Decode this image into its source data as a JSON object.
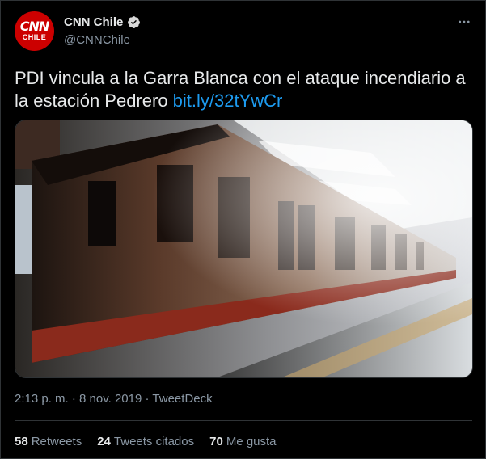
{
  "account": {
    "avatar_line1": "CNN",
    "avatar_line2": "CHILE",
    "display_name": "CNN Chile",
    "handle": "@CNNChile"
  },
  "tweet": {
    "text": "PDI vincula a la Garra Blanca con el ataque incendiario a la estación Pedrero ",
    "link": "bit.ly/32tYwCr",
    "time": "2:13 p. m.",
    "separator": "·",
    "date": "8 nov. 2019",
    "source": "TweetDeck"
  },
  "stats": [
    {
      "count": "58",
      "label": "Retweets"
    },
    {
      "count": "24",
      "label": "Tweets citados"
    },
    {
      "count": "70",
      "label": "Me gusta"
    }
  ],
  "colors": {
    "background": "#000000",
    "link": "#1d9bf0",
    "avatar": "#cc0000",
    "verified": "#d9d9d9",
    "secondary_text": "#8b98a5"
  },
  "icons": {
    "verified": "verified-badge-icon",
    "more": "more-options-icon"
  }
}
